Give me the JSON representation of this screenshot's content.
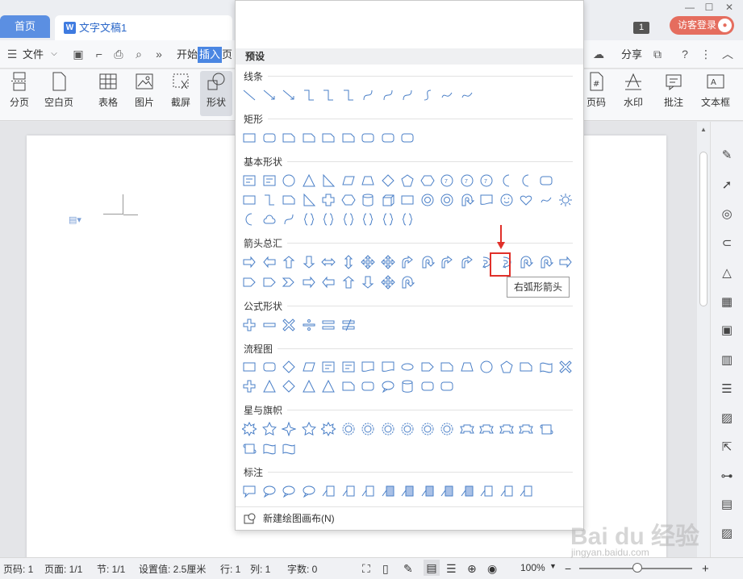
{
  "tabs": {
    "home": "首页",
    "doc": "文字文稿1"
  },
  "titlebar": {
    "badge": "1",
    "login": "访客登录"
  },
  "menu": {
    "file": "文件",
    "start": "开始",
    "insert": "插入",
    "page_partial": "页面",
    "share": "分享"
  },
  "toolbar": {
    "page_break": "分页",
    "blank_page": "空白页",
    "table": "表格",
    "picture": "图片",
    "screenshot": "截屏",
    "shape": "形状",
    "page_num": "页码",
    "watermark": "水印",
    "comment": "批注",
    "textbox": "文本框"
  },
  "dropdown": {
    "preset": "预设",
    "sections": {
      "lines": "线条",
      "rect": "矩形",
      "basic": "基本形状",
      "arrows": "箭头总汇",
      "formula": "公式形状",
      "flowchart": "流程图",
      "stars": "星与旗帜",
      "callouts": "标注"
    },
    "tooltip": "右弧形箭头",
    "new_canvas": "新建绘图画布(N)"
  },
  "status": {
    "page_num": "页码: 1",
    "page": "页面: 1/1",
    "section": "节: 1/1",
    "setting": "设置值: 2.5厘米",
    "row": "行: 1",
    "col": "列: 1",
    "words": "字数: 0",
    "zoom": "100%"
  },
  "watermark": {
    "logo": "Bai du 经验",
    "url": "jingyan.baidu.com"
  },
  "colors": {
    "accent": "#4a86e2",
    "shape_stroke": "#4a7fc7",
    "highlight": "#e0302a",
    "login": "#e56d5e"
  }
}
